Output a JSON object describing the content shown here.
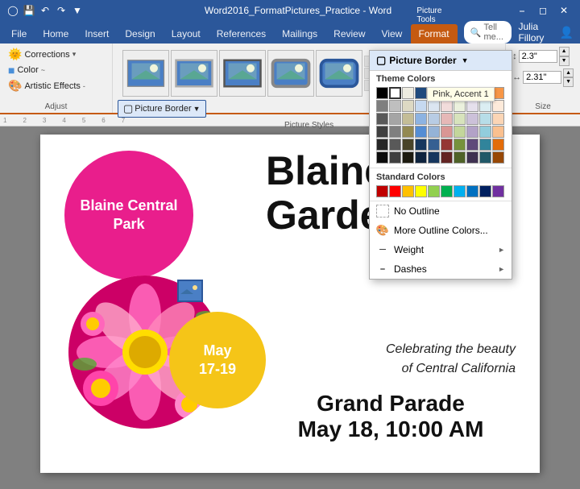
{
  "titleBar": {
    "filename": "Word2016_FormatPictures_Practice - Word",
    "icons": [
      "circle-icon",
      "undo-icon",
      "redo-icon"
    ],
    "windowControls": [
      "minimize",
      "restore",
      "close"
    ]
  },
  "tabs": {
    "main": [
      "File",
      "Home",
      "Insert",
      "Design",
      "Layout",
      "References",
      "Mailings",
      "Review",
      "View"
    ],
    "activeMain": "References",
    "pictureTools": "Picture Tools",
    "format": "Format",
    "activeFormat": true
  },
  "ribbon": {
    "adjust": {
      "label": "Adjust",
      "corrections": "Corrections",
      "correctionsCaret": "▾",
      "color": "Color",
      "colorCaret": "~",
      "artisticEffects": "Artistic Effects",
      "artisticCaret": "-"
    },
    "pictureStyles": {
      "label": "Picture Styles"
    },
    "pictureBorderBtn": {
      "label": "Picture Border",
      "caret": "▾"
    },
    "size": {
      "label": "Size",
      "heightLabel": "▲",
      "widthLabel": "▼",
      "heightValue": "2.3\"",
      "widthValue": "2.31\""
    }
  },
  "dropdown": {
    "header": "Picture Border",
    "themeColorsLabel": "Theme Colors",
    "standardColorsLabel": "Standard Colors",
    "themeColors": [
      "#000000",
      "#ffffff",
      "#eeece1",
      "#1f497d",
      "#4f81bd",
      "#c0504d",
      "#9bbb59",
      "#8064a2",
      "#4bacc6",
      "#f79646",
      "#7f7f7f",
      "#bfbfbf",
      "#ddd9c3",
      "#c6d9f0",
      "#dbe5f1",
      "#f2dcdb",
      "#ebf1dd",
      "#e5e0ec",
      "#dbeef3",
      "#fdeada",
      "#595959",
      "#a5a5a5",
      "#c4bd97",
      "#8db3e2",
      "#b8cce4",
      "#e6b8b7",
      "#d7e3bc",
      "#ccc1d9",
      "#b7dde8",
      "#fbd5b5",
      "#3f3f3f",
      "#7f7f7f",
      "#938953",
      "#548dd4",
      "#95b3d7",
      "#d99694",
      "#c3d69b",
      "#b2a2c7",
      "#92cddc",
      "#fac08f",
      "#262626",
      "#595959",
      "#494429",
      "#17375e",
      "#366092",
      "#953734",
      "#76923c",
      "#5f497a",
      "#31849b",
      "#e36c09",
      "#0c0c0c",
      "#3f3f3f",
      "#1d1b10",
      "#0f243e",
      "#17375e",
      "#632523",
      "#4f6228",
      "#3f3151",
      "#215868",
      "#974806"
    ],
    "standardColors": [
      "#c00000",
      "#ff0000",
      "#ffc000",
      "#ffff00",
      "#92d050",
      "#00b050",
      "#00b0f0",
      "#0070c0",
      "#002060",
      "#7030a0"
    ],
    "selectedColor": "#c0504d",
    "hoveredColor": "#c0504d",
    "tooltipText": "Pink, Accent 1",
    "noOutline": "No Outline",
    "moreOutlineColors": "More Outline Colors...",
    "weight": "Weight",
    "dashes": "Dashes"
  },
  "document": {
    "blaineParkTitle": "Blaine Central Park",
    "festivalTitle": "Blaine F",
    "festivalTitle2": "Garden F",
    "festivalFull": "Blaine Flower Garden Festival",
    "dateCircle": "May 17-19",
    "subtitle1": "Celebrating the beauty",
    "subtitle2": "of Central California",
    "grandParade": "Grand Parade",
    "paradeDate": "May 18, 10:00 AM"
  },
  "user": {
    "name": "Julia Fillory",
    "tellMe": "Tell me..."
  },
  "colors": {
    "ribbonBlue": "#2b579a",
    "pictureToolsOrange": "#c55a11",
    "pinkCircle": "#e91e8c",
    "yellowCircle": "#f5c518",
    "dropdownBorder": "#aaaaaa"
  }
}
